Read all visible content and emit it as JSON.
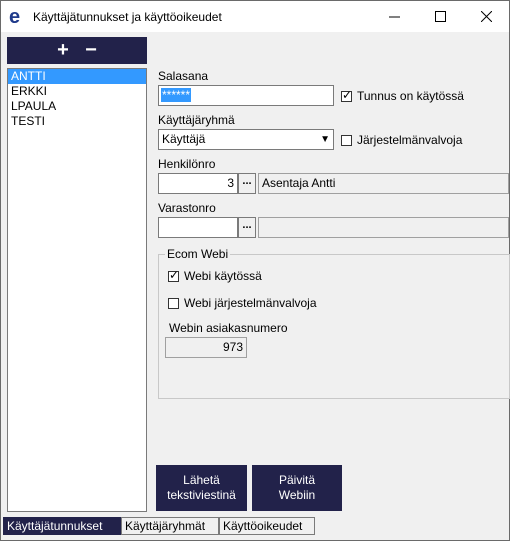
{
  "window": {
    "title": "Käyttäjätunnukset ja käyttöoikeudet",
    "app_icon": "e-logo-icon",
    "controls": [
      "minimize-icon",
      "maximize-icon",
      "close-icon"
    ]
  },
  "toolbar": {
    "add_label": "+",
    "remove_label": "−"
  },
  "users": [
    "ANTTI",
    "ERKKI",
    "LPAULA",
    "TESTI"
  ],
  "selected_user": "ANTTI",
  "form": {
    "password_label": "Salasana",
    "password_value": "******",
    "account_enabled_label": "Tunnus on käytössä",
    "account_enabled": true,
    "usergroup_label": "Käyttäjäryhmä",
    "usergroup_value": "Käyttäjä",
    "sysadmin_label": "Järjestelmänvalvoja",
    "sysadmin": false,
    "employee_no_label": "Henkilönro",
    "employee_no_value": "3",
    "employee_name_value": "Asentaja Antti",
    "ellipsis_label": "...",
    "warehouse_no_label": "Varastonro",
    "warehouse_no_value": "",
    "warehouse_name_value": ""
  },
  "ecom": {
    "group_title": "Ecom Webi",
    "webi_enabled_label": "Webi käytössä",
    "webi_enabled": true,
    "webi_admin_label": "Webi järjestelmänvalvoja",
    "webi_admin": false,
    "customer_no_label": "Webin asiakasnumero",
    "customer_no_value": "973"
  },
  "buttons": {
    "send_sms": "Lähetä\ntekstiviestinä",
    "update_webi": "Päivitä\nWebiin"
  },
  "tabs": [
    {
      "label": "Käyttäjätunnukset",
      "active": true
    },
    {
      "label": "Käyttäjäryhmät",
      "active": false
    },
    {
      "label": "Käyttöoikeudet",
      "active": false
    }
  ],
  "colors": {
    "navy": "#22224a",
    "selection": "#3399ff",
    "logo": "#1f3a8a"
  }
}
